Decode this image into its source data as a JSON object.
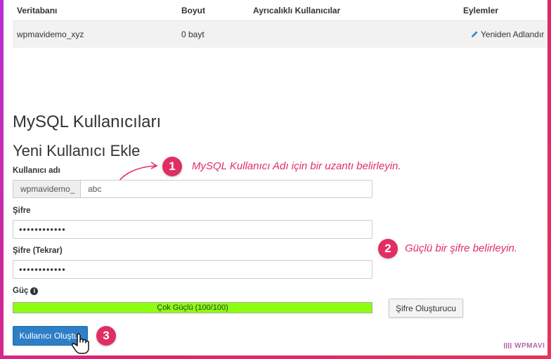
{
  "table": {
    "headers": [
      "Veritabanı",
      "Boyut",
      "Ayrıcalıklı Kullanıcılar",
      "Eylemler"
    ],
    "rows": [
      {
        "database": "wpmavidemo_xyz",
        "size": "0 bayt",
        "users": "",
        "action": "Yeniden Adlandır"
      }
    ]
  },
  "section": {
    "mysql_users_title": "MySQL Kullanıcıları",
    "new_user_title": "Yeni Kullanıcı Ekle"
  },
  "form": {
    "username_label": "Kullanıcı adı",
    "username_prefix": "wpmavidemo_",
    "username_value": "abc",
    "password_label": "Şifre",
    "password_value": "••••••••••••",
    "password_confirm_label": "Şifre (Tekrar)",
    "password_confirm_value": "••••••••••••",
    "strength_label": "Güç",
    "strength_text": "Çok Güçlü (100/100)",
    "strength_percent": 100,
    "generator_button": "Şifre Oluşturucu",
    "create_button": "Kullanıcı Oluştur"
  },
  "annotations": {
    "step1_number": "1",
    "step1_text": "MySQL Kullanıcı Adı için bir uzantı belirleyin.",
    "step2_number": "2",
    "step2_text": "Güçlü bir şifre belirleyin.",
    "step3_number": "3"
  },
  "watermark": "WPMAVI",
  "colors": {
    "accent_pink": "#e02e63",
    "primary_blue": "#2d7fc7",
    "strength_green": "#8bff0f",
    "link_blue": "#2f7fc0"
  },
  "icons": [
    "pencil-icon",
    "info-icon",
    "hand-cursor-icon",
    "arrow-icon"
  ]
}
